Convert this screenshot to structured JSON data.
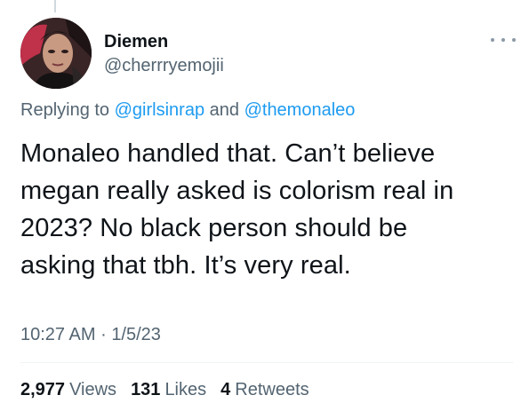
{
  "tweet": {
    "author": {
      "name": "Diemen",
      "handle": "@cherrryemojii",
      "avatar_icon": "profile-photo"
    },
    "more_icon": "more-horizontal-icon",
    "replying": {
      "prefix": "Replying to",
      "mention_1": "@girlsinrap",
      "conjunction": "and",
      "mention_2": "@themonaleo"
    },
    "text_lines": [
      "Monaleo handled that. Can’t believe",
      "megan really asked is colorism real in",
      "2023? No black person should be",
      "asking that tbh. It’s very real."
    ],
    "time": "10:27 AM",
    "separator": "·",
    "date": "1/5/23",
    "stats": {
      "views_count": "2,977",
      "views_label": "Views",
      "likes_count": "131",
      "likes_label": "Likes",
      "retweets_count": "4",
      "retweets_label": "Retweets"
    }
  },
  "colors": {
    "text": "#0f1419",
    "secondary": "#536471",
    "link": "#1d9bf0",
    "divider": "#eff3f4"
  }
}
